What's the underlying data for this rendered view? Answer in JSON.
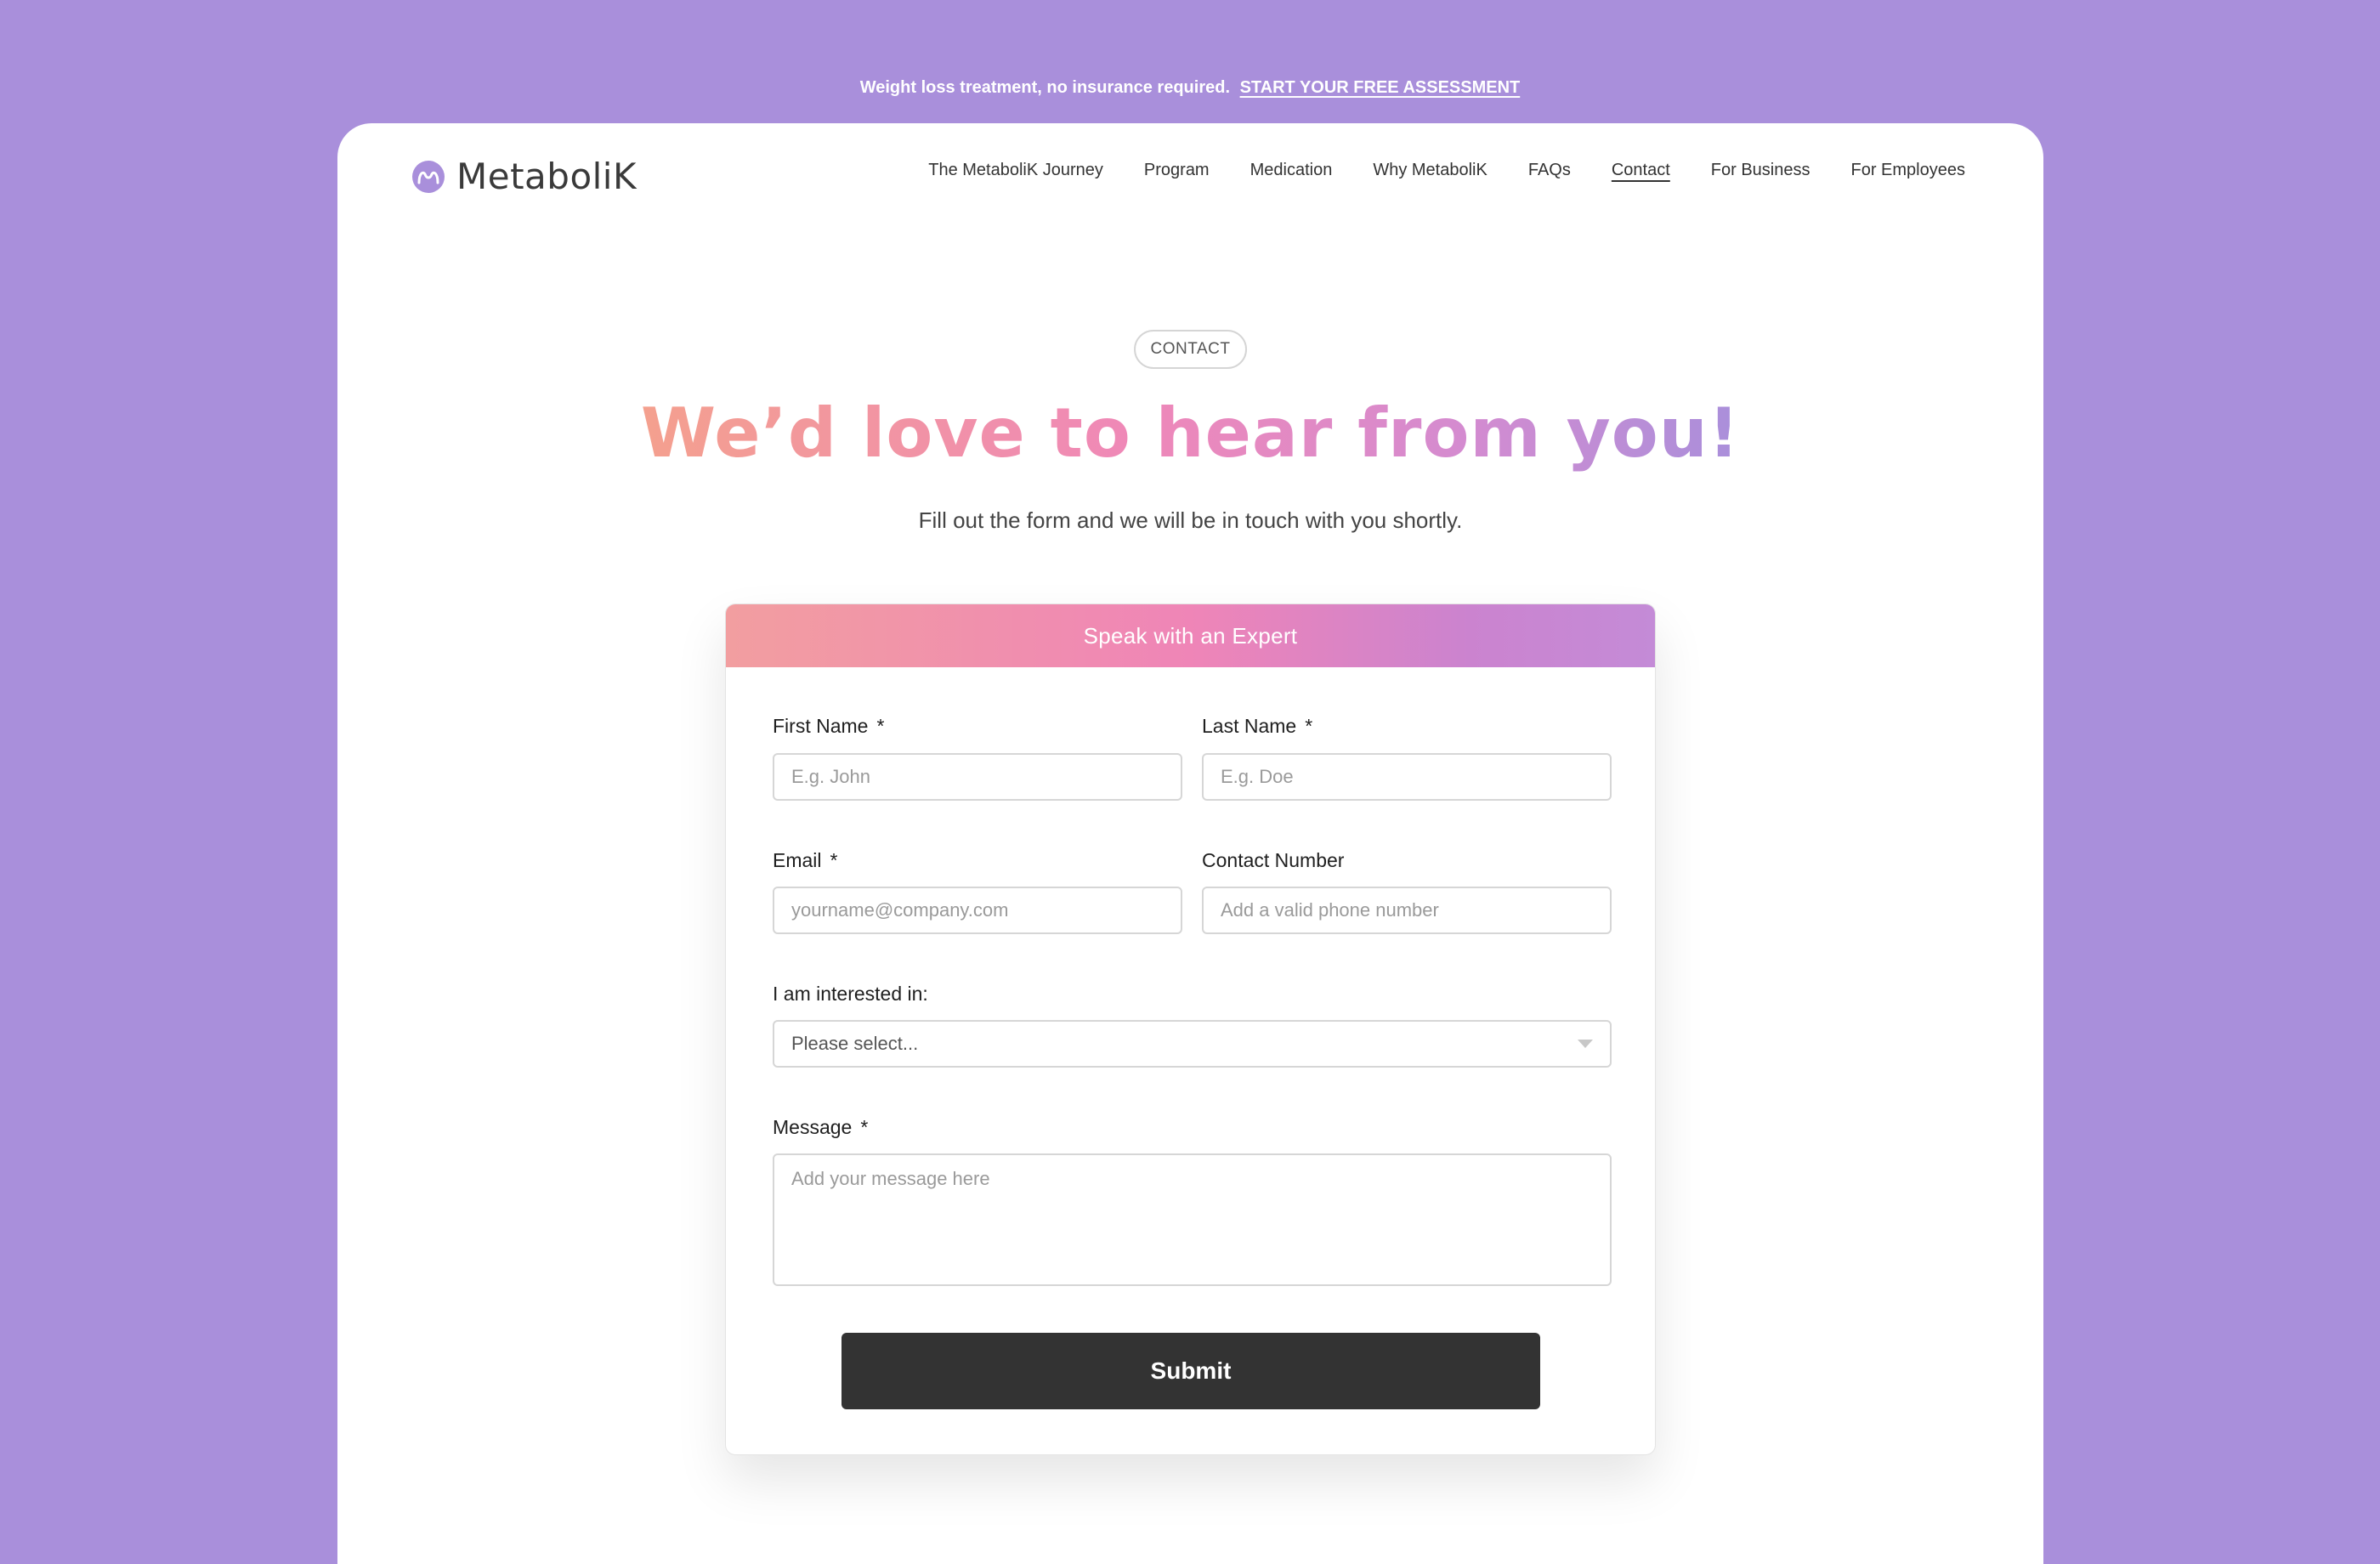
{
  "announcement": {
    "text": "Weight loss treatment, no insurance required.",
    "cta": "START YOUR FREE ASSESSMENT"
  },
  "brand": {
    "name": "MetaboliK"
  },
  "nav": {
    "items": [
      {
        "label": "The MetaboliK Journey"
      },
      {
        "label": "Program"
      },
      {
        "label": "Medication"
      },
      {
        "label": "Why MetaboliK"
      },
      {
        "label": "FAQs"
      },
      {
        "label": "Contact",
        "active": true
      },
      {
        "label": "For Business"
      },
      {
        "label": "For Employees"
      }
    ]
  },
  "hero": {
    "badge": "CONTACT",
    "headline": "We’d love to hear from you!",
    "subtitle": "Fill out the form and we will be in touch with you shortly."
  },
  "form": {
    "title": "Speak with an Expert",
    "first_name": {
      "label": "First Name",
      "required": "*",
      "placeholder": "E.g. John",
      "value": ""
    },
    "last_name": {
      "label": "Last Name",
      "required": "*",
      "placeholder": "E.g. Doe",
      "value": ""
    },
    "email": {
      "label": "Email",
      "required": "*",
      "placeholder": "yourname@company.com",
      "value": ""
    },
    "contact_number": {
      "label": "Contact Number",
      "placeholder": "Add a valid phone number",
      "value": ""
    },
    "interest": {
      "label": "I am interested in:",
      "selected": "Please select..."
    },
    "message": {
      "label": "Message",
      "required": "*",
      "placeholder": "Add your message here",
      "value": ""
    },
    "submit_label": "Submit"
  },
  "colors": {
    "background": "#a98fdb",
    "gradient_start": "#f4a08e",
    "gradient_mid": "#ef88b8",
    "gradient_end": "#a98fdb",
    "button": "#333333"
  }
}
